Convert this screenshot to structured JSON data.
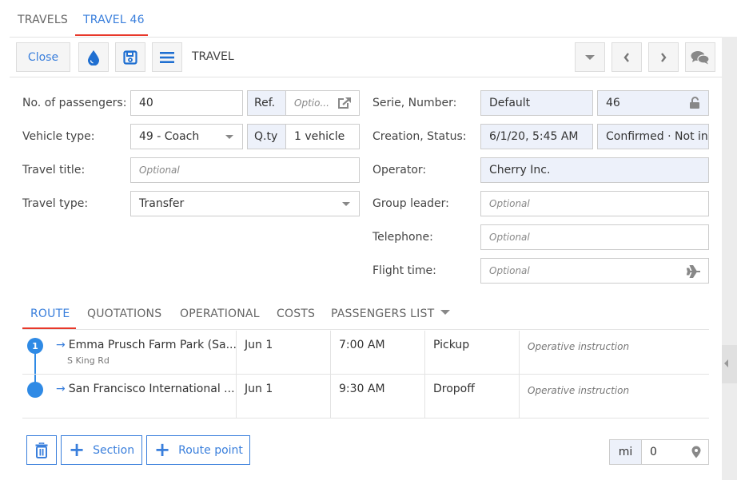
{
  "top_tabs": [
    {
      "label": "TRAVELS",
      "active": false
    },
    {
      "label": "TRAVEL 46",
      "active": true
    }
  ],
  "toolbar": {
    "close_label": "Close",
    "title": "TRAVEL",
    "icons": [
      "drop-icon",
      "save-icon",
      "menu-icon",
      "caret-down-icon",
      "chevron-left-icon",
      "chevron-right-icon",
      "comments-icon"
    ]
  },
  "form": {
    "passengers": {
      "label": "No. of passengers:",
      "value": "40",
      "ref_addon": "Ref.",
      "ref_placeholder": "Optio..."
    },
    "vehicle": {
      "label": "Vehicle type:",
      "value": "49 - Coach",
      "qty_addon": "Q.ty",
      "qty_value": "1 vehicle"
    },
    "travel_title": {
      "label": "Travel title:",
      "placeholder": "Optional"
    },
    "travel_type": {
      "label": "Travel type:",
      "value": "Transfer"
    },
    "serie_number": {
      "label": "Serie, Number:",
      "serie": "Default",
      "number": "46"
    },
    "creation_status": {
      "label": "Creation, Status:",
      "creation": "6/1/20, 5:45 AM",
      "status": "Confirmed · Not in"
    },
    "operator": {
      "label": "Operator:",
      "value": "Cherry Inc."
    },
    "group_leader": {
      "label": "Group leader:",
      "placeholder": "Optional"
    },
    "telephone": {
      "label": "Telephone:",
      "placeholder": "Optional"
    },
    "flight_time": {
      "label": "Flight time:",
      "placeholder": "Optional"
    }
  },
  "section_tabs": [
    {
      "label": "ROUTE",
      "active": true
    },
    {
      "label": "QUOTATIONS",
      "active": false
    },
    {
      "label": "OPERATIONAL",
      "active": false
    },
    {
      "label": "COSTS",
      "active": false
    },
    {
      "label": "PASSENGERS LIST",
      "active": false
    }
  ],
  "route": [
    {
      "index": "1",
      "place": "Emma Prusch Farm Park (Sa...",
      "sub": "S King Rd",
      "date": "Jun 1",
      "time": "7:00 AM",
      "type": "Pickup",
      "instruction_placeholder": "Operative instruction"
    },
    {
      "index": "",
      "place": "San Francisco International ...",
      "sub": "",
      "date": "Jun 1",
      "time": "9:30 AM",
      "type": "Dropoff",
      "instruction_placeholder": "Operative instruction"
    }
  ],
  "bottom": {
    "section_label": "Section",
    "route_point_label": "Route point",
    "unit_addon": "mi",
    "distance_value": "0"
  },
  "colors": {
    "accent": "#3a7fdc",
    "tab_underline": "#e8382a",
    "readonly_bg": "#edf1fa",
    "timeline": "#2f8ae5"
  }
}
